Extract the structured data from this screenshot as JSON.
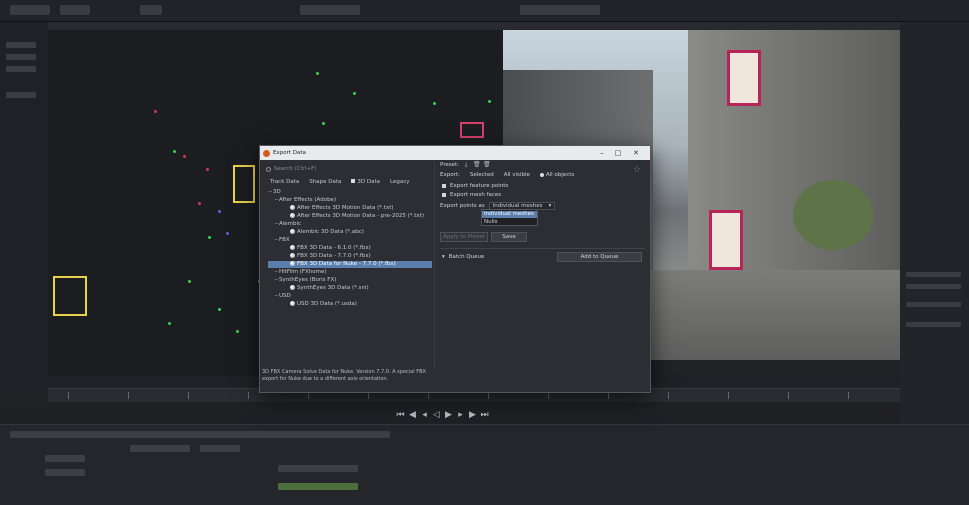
{
  "dialog": {
    "title": "Export Data",
    "search_placeholder": "Search (Ctrl+F)",
    "tabs": [
      {
        "label": "Track Data",
        "active": false
      },
      {
        "label": "Shape Data",
        "active": false
      },
      {
        "label": "3D Data",
        "active": true
      },
      {
        "label": "Legacy",
        "active": false
      }
    ],
    "tree": [
      {
        "label": "3D",
        "level": 0,
        "type": "group"
      },
      {
        "label": "After Effects (Adobe)",
        "level": 1,
        "type": "group"
      },
      {
        "label": "After Effects 3D Motion Data (*.txt)",
        "level": 2,
        "type": "item"
      },
      {
        "label": "After Effects 3D Motion Data - pre-2025 (*.txt)",
        "level": 2,
        "type": "item"
      },
      {
        "label": "Alembic",
        "level": 1,
        "type": "group"
      },
      {
        "label": "Alembic 3D Data (*.abc)",
        "level": 2,
        "type": "item"
      },
      {
        "label": "FBX",
        "level": 1,
        "type": "group"
      },
      {
        "label": "FBX 3D Data - 6.1.0 (*.fbx)",
        "level": 2,
        "type": "item"
      },
      {
        "label": "FBX 3D Data - 7.7.0 (*.fbx)",
        "level": 2,
        "type": "item"
      },
      {
        "label": "FBX 3D Data for Nuke - 7.7.0 (*.fbx)",
        "level": 2,
        "type": "item",
        "selected": true
      },
      {
        "label": "HitFilm (FXhome)",
        "level": 1,
        "type": "group"
      },
      {
        "label": "SynthEyes (Boris FX)",
        "level": 1,
        "type": "group"
      },
      {
        "label": "SynthEyes 3D Data (*.sni)",
        "level": 2,
        "type": "item"
      },
      {
        "label": "USD",
        "level": 1,
        "type": "group"
      },
      {
        "label": "USD 3D Data (*.usda)",
        "level": 2,
        "type": "item"
      }
    ],
    "description": "3D FBX Camera Solve Data for Nuke. Version 7.7.0. A special FBX export for Nuke due to a different axis orientation.",
    "preset_label": "Preset:",
    "export_label": "Export:",
    "export_options": [
      {
        "label": "Selected",
        "checked": false
      },
      {
        "label": "All visible",
        "checked": false
      },
      {
        "label": "All objects",
        "checked": true
      }
    ],
    "checkbox_feature_points": "Export feature points",
    "checkbox_mesh_faces": "Export mesh faces",
    "export_points_as_label": "Export points as",
    "export_points_as_value": "Individual meshes",
    "dropdown_options": [
      "Individual meshes",
      "Nulls"
    ],
    "dropdown_highlight": 0,
    "btn_save_disabled": "Apply to Preset",
    "btn_save": "Save",
    "batch_queue_label": "Batch Queue",
    "add_to_queue": "Add to Queue"
  },
  "colors": {
    "selection": "#5a7fae",
    "point_green": "#37d34a",
    "point_red": "#d13a4c",
    "camera_yellow": "#e8d24a"
  }
}
